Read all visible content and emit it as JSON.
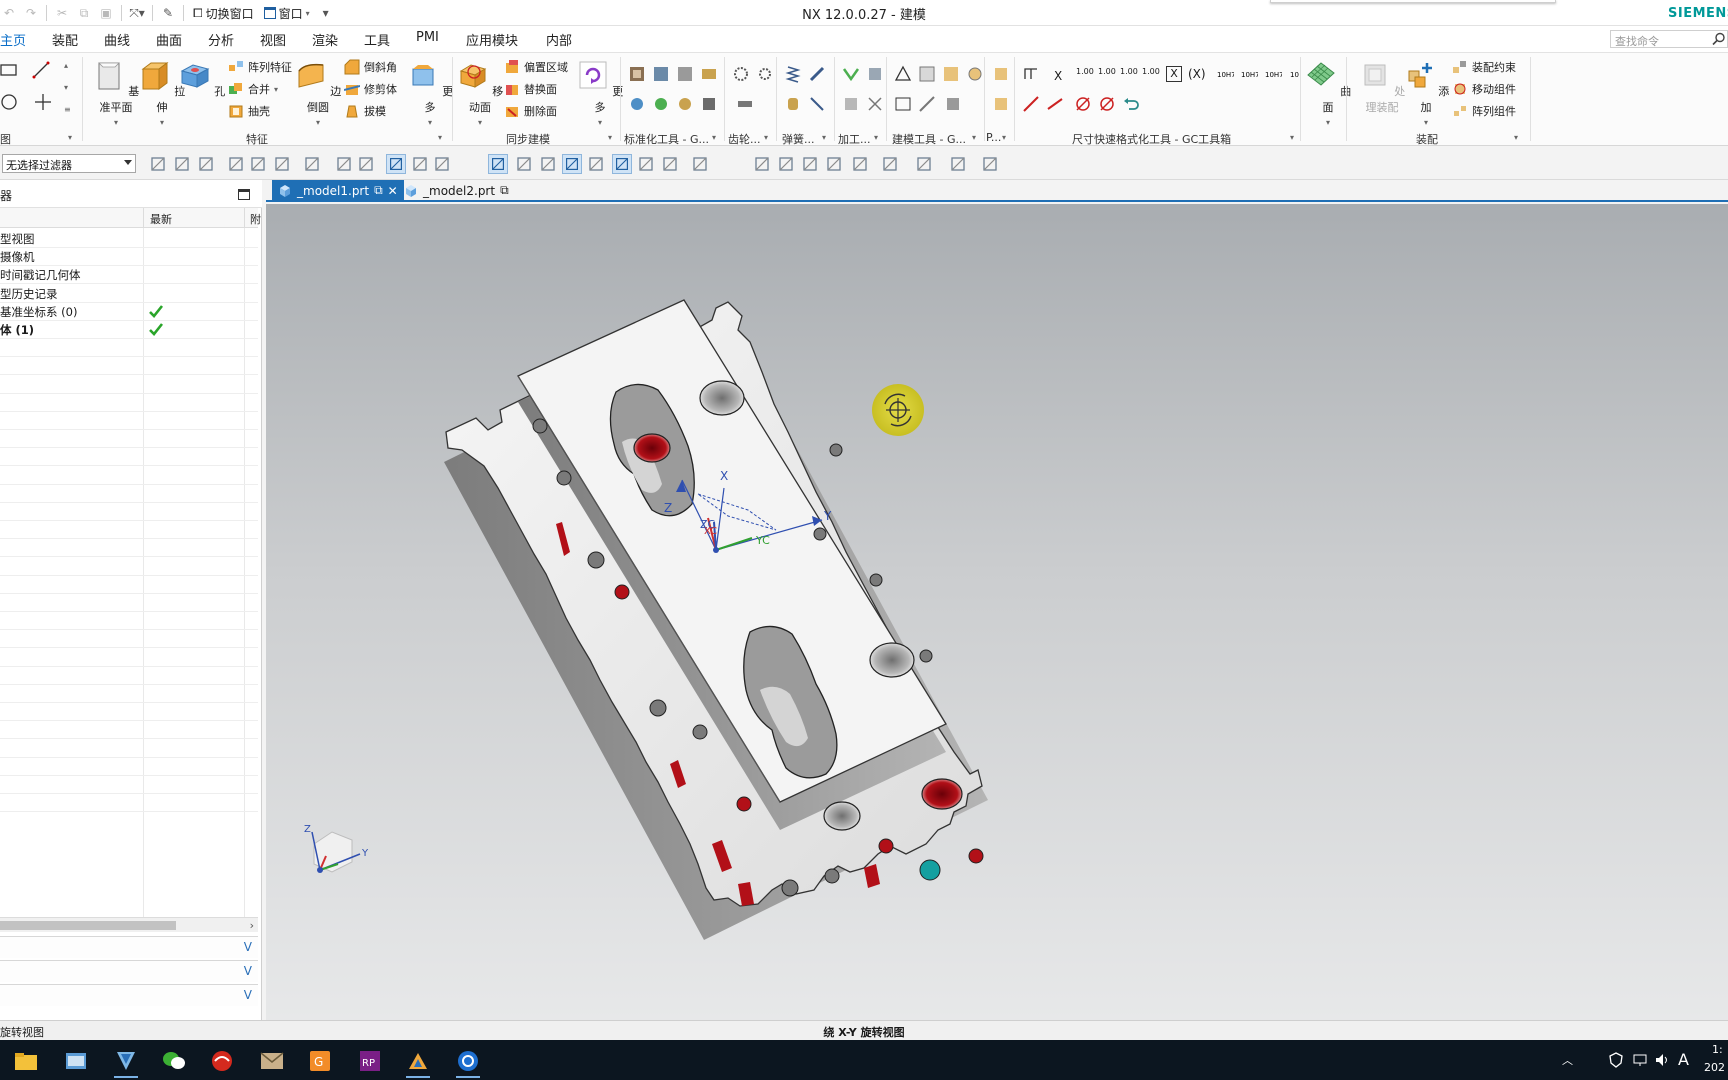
{
  "titlebar": {
    "app_title": "NX 12.0.0.27 - 建模",
    "brand": "SIEMENS",
    "quick_access": {
      "switch_window": "切换窗口",
      "window_menu": "窗口"
    }
  },
  "ribbon_tabs": [
    "主页",
    "装配",
    "曲线",
    "曲面",
    "分析",
    "视图",
    "渲染",
    "工具",
    "PMI",
    "应用模块",
    "内部"
  ],
  "ribbon_active_tab": "主页",
  "search": {
    "placeholder": "查找命令"
  },
  "ribbon": {
    "feature_group": {
      "datum_plane": "基准平面",
      "extrude": "拉伸",
      "hole": "孔",
      "pattern_feature": "阵列特征",
      "unite": "合并",
      "shell": "抽壳",
      "edge_blend": "边倒圆",
      "chamfer": "倒斜角",
      "trim_body": "修剪体",
      "draft": "拔模",
      "more": "更多",
      "label": "特征"
    },
    "sync_group": {
      "move_face": "移动面",
      "offset_region": "偏置区域",
      "replace_face": "替换面",
      "delete_face": "删除面",
      "more": "更多",
      "label": "同步建模"
    },
    "direct_sketch_label": "图",
    "std_tools_label": "标准化工具 - G...",
    "gear_label": "齿轮...",
    "spring_label": "弹簧...",
    "machining_label": "加工...",
    "modeling_tools_label": "建模工具 - G...",
    "p_label": "P...",
    "dimension_label": "尺寸快速格式化工具 - GC工具箱",
    "dim_x": "X",
    "dim_xp": "(X)",
    "dim_vals": [
      "1.00",
      "1.00",
      "1.00",
      "1.00"
    ],
    "surface_label": "曲面",
    "assembly": {
      "process_assembly": "处理装配",
      "add": "添加",
      "constraint": "装配约束",
      "move_component": "移动组件",
      "pattern_component": "阵列组件",
      "label": "装配"
    }
  },
  "selection_bar": {
    "filter_value": "无选择过滤器"
  },
  "navigator": {
    "title": "器",
    "columns": [
      "",
      "最新",
      "附"
    ],
    "rows": [
      {
        "label": "型视图",
        "latest": false,
        "bold": false
      },
      {
        "label": "摄像机",
        "latest": false,
        "bold": false
      },
      {
        "label": "时间戳记几何体",
        "latest": false,
        "bold": false
      },
      {
        "label": "型历史记录",
        "latest": false,
        "bold": false
      },
      {
        "label": "基准坐标系 (0)",
        "latest": true,
        "bold": false
      },
      {
        "label": "体 (1)",
        "latest": true,
        "bold": true
      }
    ]
  },
  "document_tabs": [
    {
      "label": "_model1.prt",
      "active": true
    },
    {
      "label": "_model2.prt",
      "active": false
    }
  ],
  "viewport": {
    "triad_labels": {
      "x": "X",
      "y": "Y",
      "z": "Z",
      "xc": "XC",
      "yc": "YC",
      "zc": "ZC"
    }
  },
  "status": {
    "left": "旋转视图",
    "center": "绕 X-Y 旋转视图"
  },
  "taskbar": {
    "apps": [
      "file-explorer",
      "app-blue",
      "nx-launcher",
      "wechat",
      "app-red-swirl",
      "app-mail",
      "app-orange",
      "app-rp",
      "app-fish",
      "app-circle"
    ],
    "tray_time": "1:",
    "tray_date": "202",
    "ime": "A"
  },
  "colors": {
    "accent": "#1f6fb5",
    "hole_red": "#b21018",
    "hole_teal": "#14a0a0",
    "model_face": "#ededed",
    "brand": "#009999"
  }
}
